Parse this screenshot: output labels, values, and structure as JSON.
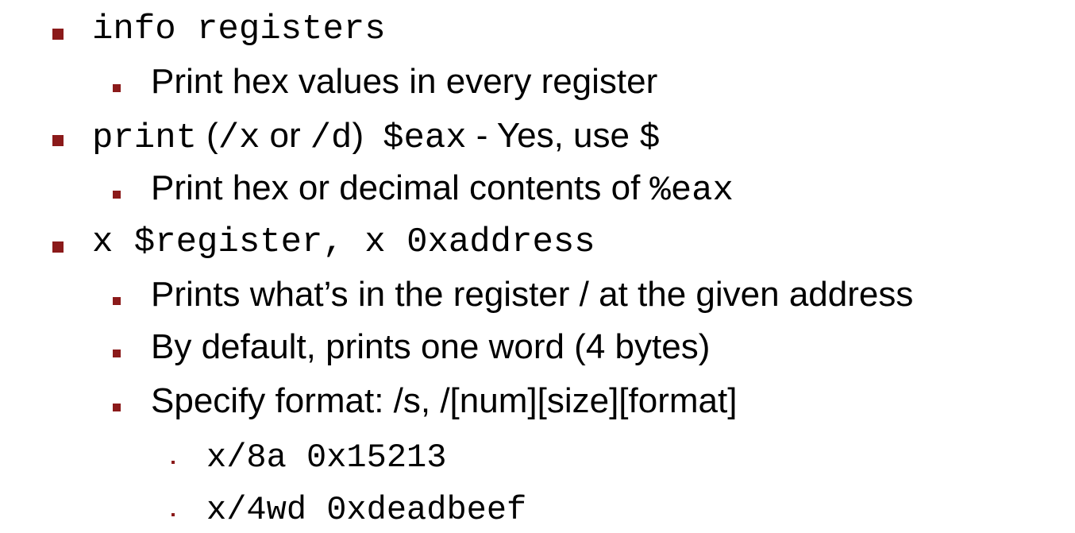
{
  "colors": {
    "bullet": "#8b1a1a",
    "text": "#000000",
    "background": "#ffffff"
  },
  "bullets": {
    "info_registers": {
      "code": "info registers"
    },
    "print_hex_values": {
      "text": "Print hex values in every register"
    },
    "print_cmd": {
      "code_print": "print",
      "paren_open": "(",
      "code_x": "/x",
      "or_text": "or",
      "code_d": "/d",
      "paren_close": ")",
      "code_eax": "$eax",
      "dash_text": "- Yes, use",
      "code_dollar": "$"
    },
    "print_hex_or_decimal": {
      "text": "Print hex or decimal contents of",
      "code": "%eax"
    },
    "x_cmd": {
      "code": "x $register, x 0xaddress"
    },
    "prints_whats_in": {
      "text": "Prints what’s in the register / at the given address"
    },
    "by_default": {
      "text": "By default, prints one word (4 bytes)"
    },
    "specify_format": {
      "text": "Specify format: /s, /[num][size][format]"
    },
    "example_1": {
      "code": "x/8a 0x15213"
    },
    "example_2": {
      "code": "x/4wd 0xdeadbeef"
    }
  }
}
